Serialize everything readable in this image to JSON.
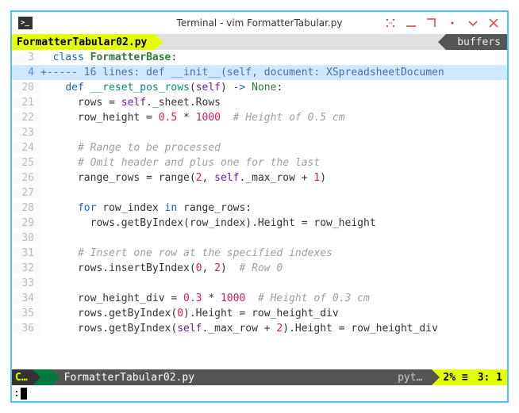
{
  "window": {
    "title": "Terminal - vim FormatterTabular.py"
  },
  "tabs": {
    "active": "FormatterTabular02.py",
    "buffers_label": "buffers"
  },
  "fold": {
    "gutter": "4",
    "text": "+----- 16 lines: def __init__(self, document: XSpreadsheetDocumen"
  },
  "code": {
    "l3": "  class FormatterBase:",
    "l20": "    def __reset_pos_rows(self) -> None:",
    "l21": "      rows = self._sheet.Rows",
    "l22": "      row_height = 0.5 * 1000  # Height of 0.5 cm",
    "l23": "",
    "l24": "      # Range to be processed",
    "l25": "      # Omit header and plus one for the last",
    "l26": "      range_rows = range(2, self._max_row + 1)",
    "l27": "",
    "l28": "      for row_index in range_rows:",
    "l29": "        rows.getByIndex(row_index).Height = row_height",
    "l30": "",
    "l31": "      # Insert one row at the specified indexes",
    "l32": "      rows.insertByIndex(0, 2)  # Row 0",
    "l33": "",
    "l34": "      row_height_div = 0.3 * 1000  # Height of 0.3 cm",
    "l35": "      rows.getByIndex(0).Height = row_height_div",
    "l36": "      rows.getByIndex(self._max_row + 2).Height = row_height_div"
  },
  "gutter": {
    "l3": "3",
    "l20": "20",
    "l21": "21",
    "l22": "22",
    "l23": "23",
    "l24": "24",
    "l25": "25",
    "l26": "26",
    "l27": "27",
    "l28": "28",
    "l29": "29",
    "l30": "30",
    "l31": "31",
    "l32": "32",
    "l33": "33",
    "l34": "34",
    "l35": "35",
    "l36": "36"
  },
  "status": {
    "mode": "C…",
    "branch": "",
    "file": "FormatterTabular02.py",
    "filetype": "pyt…",
    "percent": "2% ≡",
    "position": "3:  1"
  },
  "cmd": {
    "prompt": ":"
  }
}
